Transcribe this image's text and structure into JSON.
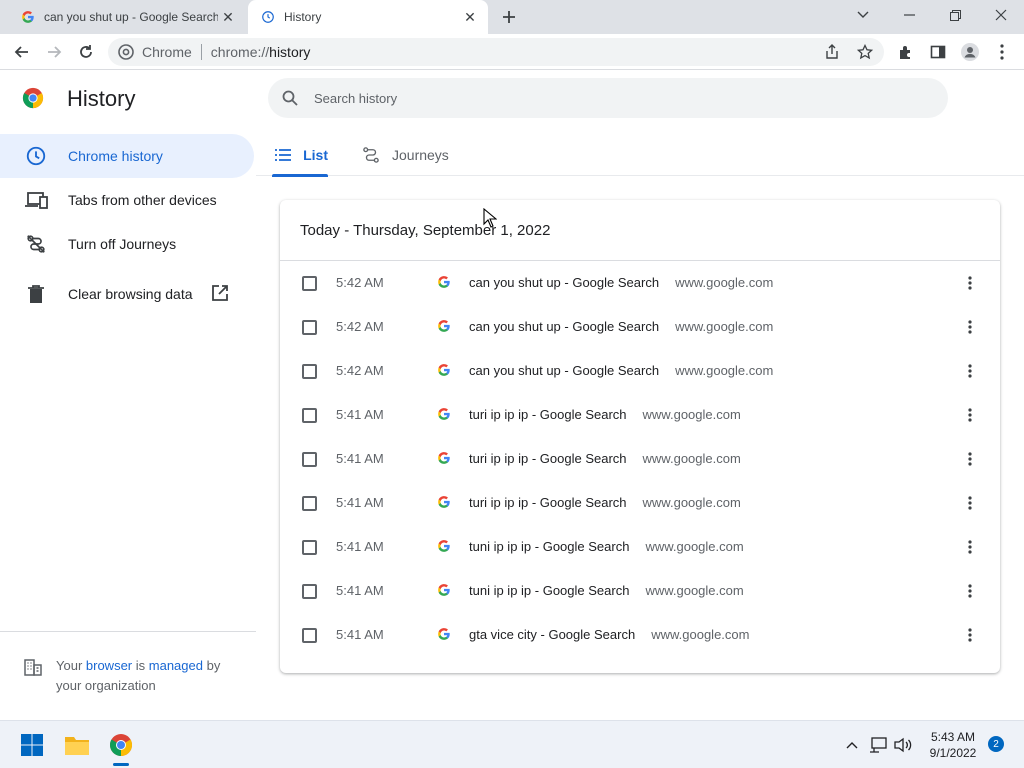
{
  "browser": {
    "tabs": [
      {
        "title": "can you shut up - Google Search",
        "favicon": "google-icon"
      },
      {
        "title": "History",
        "favicon": "history-icon"
      }
    ],
    "omnibox": {
      "chip_label": "Chrome",
      "url_prefix": "chrome://",
      "url_host": "history"
    }
  },
  "page": {
    "title": "History",
    "search_placeholder": "Search history",
    "sidebar": {
      "items": [
        {
          "label": "Chrome history",
          "icon": "clock-icon"
        },
        {
          "label": "Tabs from other devices",
          "icon": "devices-icon"
        },
        {
          "label": "Turn off Journeys",
          "icon": "journeys-off-icon"
        },
        {
          "label": "Clear browsing data",
          "icon": "trash-icon"
        }
      ],
      "managed": {
        "pre": "Your ",
        "link1": "browser",
        "mid": " is ",
        "link2": "managed",
        "post": " by your organization"
      }
    },
    "tabs": [
      {
        "label": "List"
      },
      {
        "label": "Journeys"
      }
    ],
    "date_header": "Today - Thursday, September 1, 2022",
    "rows": [
      {
        "time": "5:42 AM",
        "title": "can you shut up - Google Search",
        "domain": "www.google.com"
      },
      {
        "time": "5:42 AM",
        "title": "can you shut up - Google Search",
        "domain": "www.google.com"
      },
      {
        "time": "5:42 AM",
        "title": "can you shut up - Google Search",
        "domain": "www.google.com"
      },
      {
        "time": "5:41 AM",
        "title": "turi ip ip ip - Google Search",
        "domain": "www.google.com"
      },
      {
        "time": "5:41 AM",
        "title": "turi ip ip ip - Google Search",
        "domain": "www.google.com"
      },
      {
        "time": "5:41 AM",
        "title": "turi ip ip ip - Google Search",
        "domain": "www.google.com"
      },
      {
        "time": "5:41 AM",
        "title": "tuni ip ip ip - Google Search",
        "domain": "www.google.com"
      },
      {
        "time": "5:41 AM",
        "title": "tuni ip ip ip - Google Search",
        "domain": "www.google.com"
      },
      {
        "time": "5:41 AM",
        "title": "gta vice city - Google Search",
        "domain": "www.google.com"
      }
    ]
  },
  "taskbar": {
    "time": "5:43 AM",
    "date": "9/1/2022",
    "notification_count": "2"
  },
  "colors": {
    "accent": "#1967d2",
    "selected_bg": "#e8f0fe",
    "tabstrip": "#dee1e6",
    "taskbar_accent": "#0067c0"
  }
}
